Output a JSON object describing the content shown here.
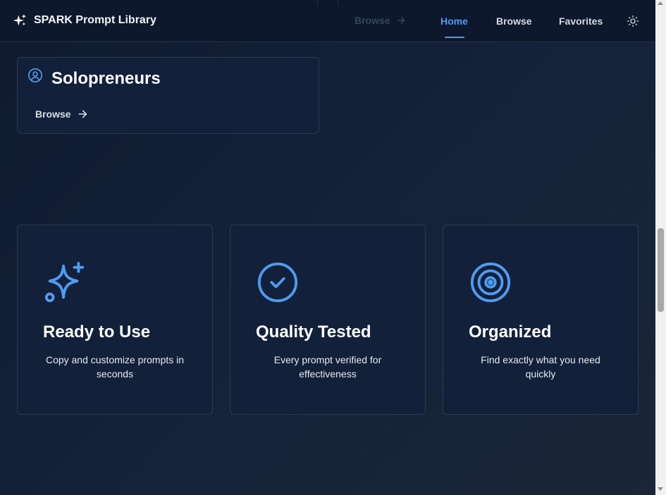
{
  "app": {
    "title": "SPARK Prompt Library",
    "brand_icon": "sparkles-icon"
  },
  "nav": {
    "home": "Home",
    "browse": "Browse",
    "favorites": "Favorites",
    "active": "Home",
    "theme_icon": "sun-icon"
  },
  "background_browse": "Browse",
  "category": {
    "icon": "user-circle-icon",
    "title": "Solopreneurs",
    "browse_label": "Browse",
    "arrow_icon": "arrow-right-icon"
  },
  "features": [
    {
      "icon": "sparkles-icon",
      "title": "Ready to Use",
      "description": "Copy and customize prompts in seconds"
    },
    {
      "icon": "check-circle-icon",
      "title": "Quality Tested",
      "description": "Every prompt verified for effectiveness"
    },
    {
      "icon": "target-icon",
      "title": "Organized",
      "description": "Find exactly what you need quickly"
    }
  ],
  "colors": {
    "accent": "#4f9bf0",
    "card_background": "#12203a",
    "card_border": "#2c3a52",
    "page_background": "#15223a"
  }
}
